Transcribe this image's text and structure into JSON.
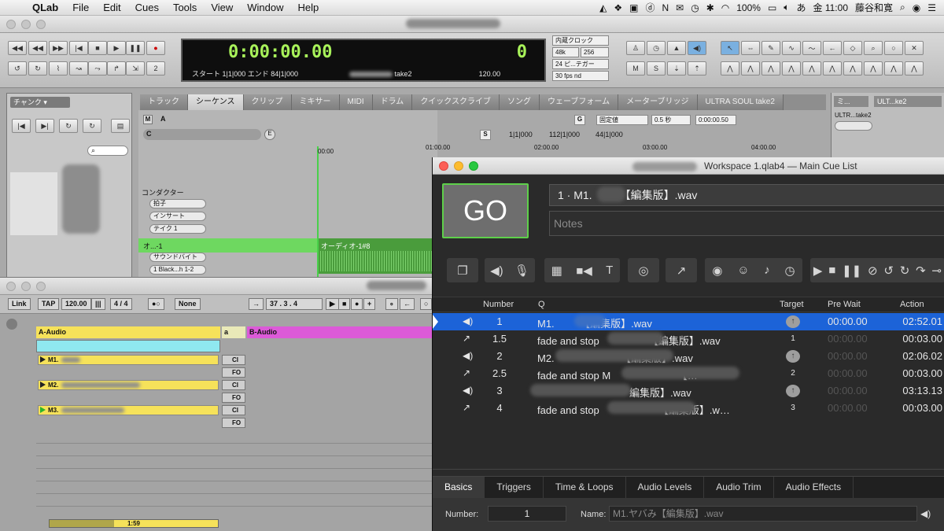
{
  "menubar": {
    "app": "QLab",
    "items": [
      "File",
      "Edit",
      "Cues",
      "Tools",
      "View",
      "Window",
      "Help"
    ],
    "battery": "100%",
    "ime": "あ",
    "clock": "金 11:00",
    "user": "藤谷和寛"
  },
  "protools": {
    "counter_main": "0:00:00.00",
    "counter_right": "0",
    "start_label": "スタート",
    "start_value": "1|1|000",
    "end_label": "エンド",
    "end_value": "84|1|000",
    "take": "take2",
    "tempo": "120.00",
    "clock_source": "内蔵クロック",
    "sample_rate": "48k",
    "buffer": "256",
    "film": "24 ピ...テガー",
    "fps": "30 fps nd",
    "tabs": [
      "トラック",
      "シーケンス",
      "クリップ",
      "ミキサー",
      "MIDI",
      "ドラム",
      "クイックスクライブ",
      "ソング",
      "ウェーブフォーム",
      "メーターブリッジ",
      "ULTRA SOUL take2"
    ],
    "selected_tab": 1,
    "left_panel_title": "チャンク",
    "conductor": "コンダクター",
    "rows": [
      "拍子",
      "インサート",
      "テイク 1",
      "サウンドバイト",
      "1 Black...h 1-2"
    ],
    "audio_track": "オ...-1",
    "audio_region": "オーディオ-1#8",
    "grid_mode": "固定値",
    "grid_value": "0.5 秒",
    "grid_time": "0:00:00.50",
    "sel_start": "1|1|000",
    "sel_end": "112|1|000",
    "sel_len": "44|1|000",
    "ruler": [
      "00:00",
      "01:00.00",
      "02:00.00",
      "03:00.00",
      "04:00.00"
    ],
    "right_tab_a": "ミ...",
    "right_tab_b": "ULT...ke2",
    "right_track": "ULTR...take2",
    "m_label": "M",
    "a_label": "A",
    "c_label": "C",
    "e_label": "E",
    "g_label": "G",
    "s_label": "S"
  },
  "ableton": {
    "link": "Link",
    "tap": "TAP",
    "bpm": "120.00",
    "sig": "4 / 4",
    "quant": "None",
    "position": "37 .  3 .  4",
    "track_a": "A-Audio",
    "track_a2": "a",
    "track_b": "B-Audio",
    "clips": [
      "M1.",
      "M2.",
      "M3."
    ],
    "ci": "CI",
    "fo": "FO",
    "time": "1:59"
  },
  "qlab": {
    "window_title": "Workspace 1.qlab4 — Main Cue List",
    "go": "GO",
    "cue_name": "1 · M1.　　　【編集版】.wav",
    "notes_placeholder": "Notes",
    "columns": {
      "number": "Number",
      "q": "Q",
      "target": "Target",
      "prewait": "Pre Wait",
      "action": "Action"
    },
    "cues": [
      {
        "type": "audio",
        "number": "1",
        "name": "M1.　　　【編集版】.wav",
        "target": "↑",
        "prewait": "00:00.00",
        "action": "02:52.01",
        "selected": true
      },
      {
        "type": "fade",
        "number": "1.5",
        "name": "fade and stop 　　　　　【編集版】.wav",
        "target": "1",
        "prewait": "00:00.00",
        "action": "00:03.00"
      },
      {
        "type": "audio",
        "number": "2",
        "name": "M2.　　　　　　　【編集版】.wav",
        "target": "↑",
        "prewait": "00:00.00",
        "action": "02:06.02"
      },
      {
        "type": "fade",
        "number": "2.5",
        "name": "fade and stop M　　　　　　　【…",
        "target": "2",
        "prewait": "00:00.00",
        "action": "00:03.00"
      },
      {
        "type": "audio",
        "number": "3",
        "name": "　　　　　　　　　編集版】.wav",
        "target": "↑",
        "prewait": "00:00.00",
        "action": "03:13.13"
      },
      {
        "type": "fade",
        "number": "4",
        "name": "fade and stop 　　　　　　【編集版】.w…",
        "target": "3",
        "prewait": "00:00.00",
        "action": "00:03.00"
      }
    ],
    "inspector_tabs": [
      "Basics",
      "Triggers",
      "Time & Loops",
      "Audio Levels",
      "Audio Trim",
      "Audio Effects"
    ],
    "inspector": {
      "number_label": "Number:",
      "number_value": "1",
      "name_label": "Name:",
      "name_value": "M1.ヤバみ【編集版】.wav"
    },
    "accent": "#5ed04a",
    "selection_color": "#1c63d8"
  }
}
